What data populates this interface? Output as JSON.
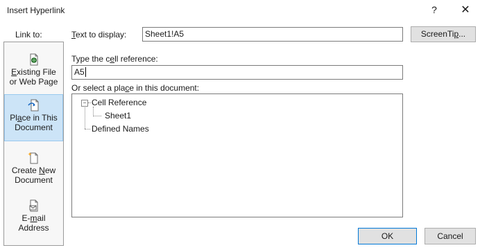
{
  "dialog": {
    "title": "Insert Hyperlink",
    "help_label": "?",
    "close_label": "✕"
  },
  "link_to": {
    "label": "Link to:",
    "items": [
      {
        "line1": "Existing File",
        "line2": "or Web Page",
        "icon": "web-file-icon"
      },
      {
        "line1": "Place in This",
        "line2": "Document",
        "icon": "document-place-icon",
        "selected": true
      },
      {
        "line1": "Create New",
        "line2": "Document",
        "icon": "new-document-icon"
      },
      {
        "line1": "E-mail",
        "line2": "Address",
        "icon": "email-icon"
      }
    ]
  },
  "text_to_display": {
    "label": "Text to display:",
    "value": "Sheet1!A5"
  },
  "screentip_button": "ScreenTip...",
  "cell_reference": {
    "label": "Type the cell reference:",
    "value": "A5"
  },
  "place_select": {
    "label": "Or select a place in this document:",
    "tree": {
      "expander": "−",
      "root": "Cell Reference",
      "child": "Sheet1",
      "second_root": "Defined Names"
    }
  },
  "ok_button": "OK",
  "cancel_button": "Cancel",
  "colors": {
    "selected_bg": "#cce4f7",
    "selected_border": "#99c9ef",
    "primary_border": "#0078d7"
  }
}
